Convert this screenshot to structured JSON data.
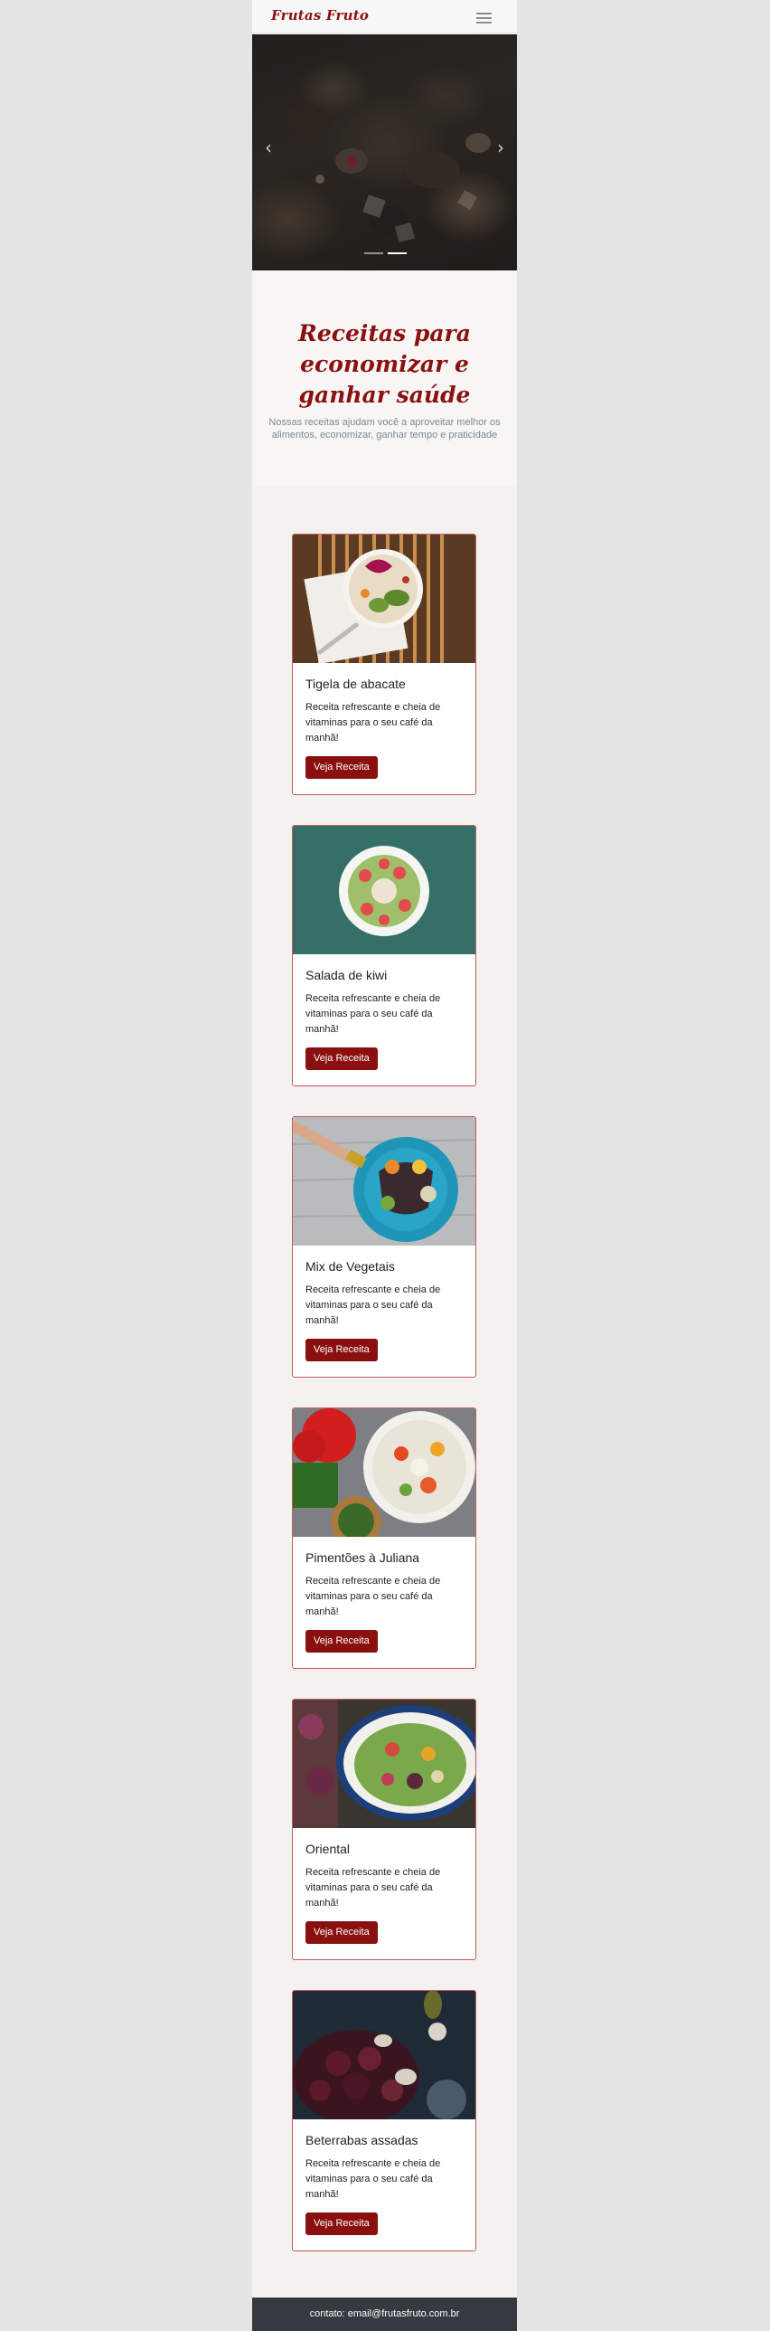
{
  "navbar": {
    "brand": "Frutas Fruto",
    "toggle_icon": "hamburger-menu-icon"
  },
  "carousel": {
    "prev_icon": "chevron-left-icon",
    "next_icon": "chevron-right-icon",
    "prev_glyph": "‹",
    "next_glyph": "›",
    "slides": 2,
    "active_slide": 2
  },
  "hero": {
    "title": "Receitas para economizar e ganhar saúde",
    "subtitle": "Nossas receitas ajudam você a aproveitar melhor os alimentos, economizar, ganhar tempo e praticidade"
  },
  "recipes": [
    {
      "title": "Tigela de abacate",
      "description": "Receita refrescante e cheia de vitaminas para o seu café da manhã!",
      "button": "Veja Receita"
    },
    {
      "title": "Salada de kiwi",
      "description": "Receita refrescante e cheia de vitaminas para o seu café da manhã!",
      "button": "Veja Receita"
    },
    {
      "title": "Mix de Vegetais",
      "description": "Receita refrescante e cheia de vitaminas para o seu café da manhã!",
      "button": "Veja Receita"
    },
    {
      "title": "Pimentões à Juliana",
      "description": "Receita refrescante e cheia de vitaminas para o seu café da manhã!",
      "button": "Veja Receita"
    },
    {
      "title": "Oriental",
      "description": "Receita refrescante e cheia de vitaminas para o seu café da manhã!",
      "button": "Veja Receita"
    },
    {
      "title": "Beterrabas assadas",
      "description": "Receita refrescante e cheia de vitaminas para o seu café da manhã!",
      "button": "Veja Receita"
    }
  ],
  "footer": {
    "contact": "contato: email@frutasfruto.com.br"
  },
  "colors": {
    "brand": "#8a1111",
    "button": "#8a0f0f",
    "card_border": "#c4595b",
    "footer": "#343a40"
  }
}
